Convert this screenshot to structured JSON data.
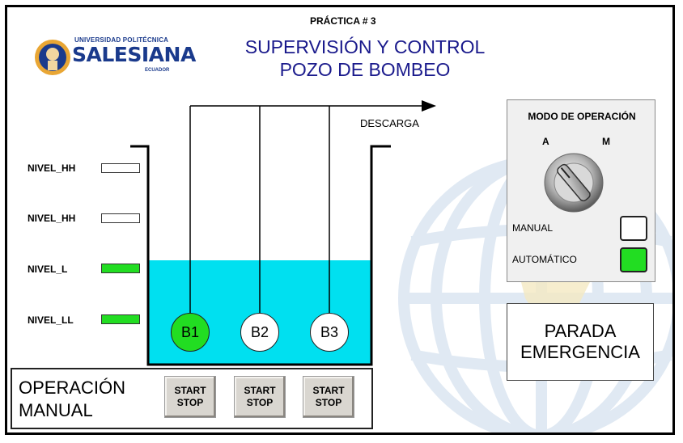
{
  "header": {
    "practice": "PRÁCTICA # 3",
    "title_line1": "SUPERVISIÓN Y CONTROL",
    "title_line2": "POZO DE BOMBEO"
  },
  "logo": {
    "university": "UNIVERSIDAD POLITÉCNICA",
    "name": "SALESIANA",
    "country": "ECUADOR"
  },
  "tank": {
    "discharge_label": "DESCARGA",
    "water_color": "#00e0f0",
    "fill_level": 0.5
  },
  "levels": [
    {
      "label": "NIVEL_HH",
      "active": false
    },
    {
      "label": "NIVEL_HH",
      "active": false
    },
    {
      "label": "NIVEL_L",
      "active": true
    },
    {
      "label": "NIVEL_LL",
      "active": true
    }
  ],
  "pumps": [
    {
      "label": "B1",
      "running": true
    },
    {
      "label": "B2",
      "running": false
    },
    {
      "label": "B3",
      "running": false
    }
  ],
  "mode_panel": {
    "title": "MODO DE OPERACIÓN",
    "auto_short": "A",
    "manual_short": "M",
    "manual_label": "MANUAL",
    "manual_active": false,
    "auto_label": "AUTOMÁTICO",
    "auto_active": true
  },
  "emergency": {
    "line1": "PARADA",
    "line2": "EMERGENCIA"
  },
  "manual_operation": {
    "line1": "OPERACIÓN",
    "line2": "MANUAL",
    "buttons": [
      {
        "start": "START",
        "stop": "STOP"
      },
      {
        "start": "START",
        "stop": "STOP"
      },
      {
        "start": "START",
        "stop": "STOP"
      }
    ]
  },
  "colors": {
    "active_green": "#22dd22",
    "inactive": "#ffffff",
    "title_blue": "#1a1a8c"
  }
}
